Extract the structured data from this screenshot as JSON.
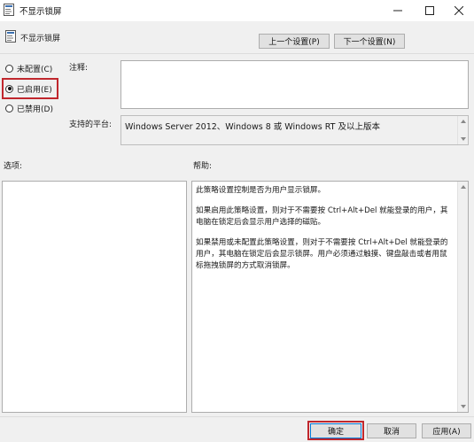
{
  "window": {
    "title": "不显示锁屏",
    "minimize_glyph": "—",
    "maximize_glyph": "☐",
    "close_glyph": "✕"
  },
  "header": {
    "policy_name": "不显示锁屏",
    "prev_button": "上一个设置(P)",
    "next_button": "下一个设置(N)"
  },
  "state": {
    "options": [
      {
        "label": "未配置(C)",
        "selected": false
      },
      {
        "label": "已启用(E)",
        "selected": true
      },
      {
        "label": "已禁用(D)",
        "selected": false
      }
    ]
  },
  "comment": {
    "label": "注释:",
    "value": ""
  },
  "platform": {
    "label": "支持的平台:",
    "value": "Windows Server 2012、Windows 8 或 Windows RT 及以上版本"
  },
  "options_section": {
    "label": "选项:"
  },
  "help_section": {
    "label": "帮助:",
    "paragraphs": [
      "此策略设置控制是否为用户显示锁屏。",
      "如果启用此策略设置，则对于不需要按 Ctrl+Alt+Del 就能登录的用户，其电脑在锁定后会显示用户选择的磁贴。",
      "如果禁用或未配置此策略设置，则对于不需要按 Ctrl+Alt+Del 就能登录的用户，其电脑在锁定后会显示锁屏。用户必须通过触摸、键盘敲击或者用鼠标拖拽锁屏的方式取消锁屏。"
    ]
  },
  "footer": {
    "ok": "确定",
    "cancel": "取消",
    "apply": "应用(A)"
  },
  "colors": {
    "highlight": "#c0272d",
    "window_bg": "#f0f0f0"
  },
  "icons": [
    "policy-icon",
    "minimize-icon",
    "maximize-icon",
    "close-icon",
    "scroll-up-icon",
    "scroll-down-icon"
  ]
}
